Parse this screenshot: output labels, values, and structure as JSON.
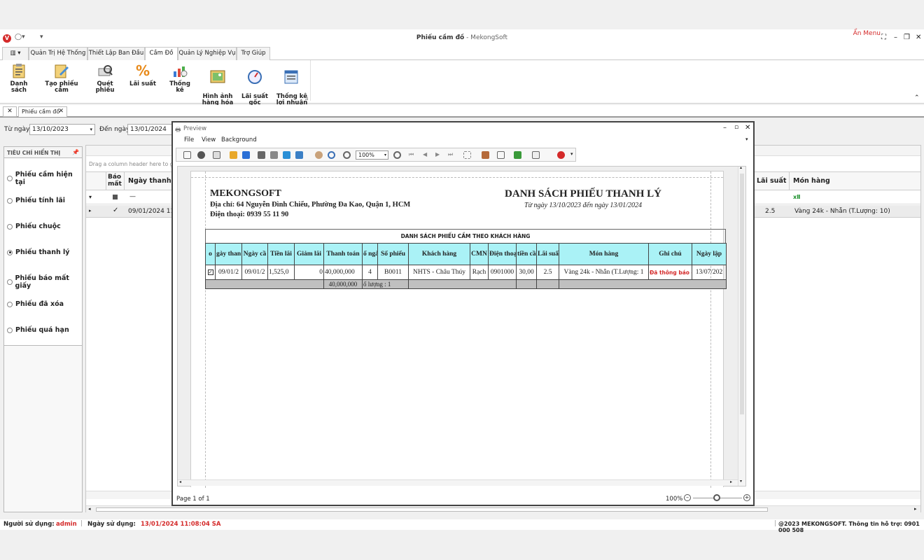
{
  "window": {
    "title_bold": "Phiếu cầm đồ",
    "title_rest": " - MekongSoft",
    "hide_menu": "Ẩn Menu",
    "logo": "V"
  },
  "tabs": [
    "Quản Trị Hệ Thống",
    "Thiết Lập Ban Đầu",
    "Cầm Đồ",
    "Quản Lý Nghiệp Vụ",
    "Trợ Giúp"
  ],
  "ribbon": {
    "buttons": [
      "Danh sách",
      "Tạo phiếu cầm",
      "Quét phiếu",
      "Lãi suất",
      "Thống kê",
      "Hình ảnh\nhàng hóa",
      "Lãi suất\ngốc",
      "Thống kê\nlợi nhuận"
    ]
  },
  "doc_tab": "Phiếu cầm đồ",
  "filter": {
    "from_label": "Từ ngày",
    "from_value": "13/10/2023",
    "to_label": "Đến ngày",
    "to_value": "13/01/2024"
  },
  "left_panel": {
    "header": "TIÊU CHÍ HIỂN THỊ",
    "options": [
      "Phiếu cầm hiện tại",
      "Phiếu tính lãi",
      "Phiếu chuộc",
      "Phiếu thanh lý",
      "Phiếu báo mất giấy",
      "Phiếu đã xóa",
      "Phiếu quá hạn"
    ],
    "selected": "Phiếu thanh lý"
  },
  "grid": {
    "group_hint": "Drag a column header here to grou",
    "headers": {
      "bao_mat": "Báo mất",
      "ngay_thanh": "Ngày thanh l",
      "lai_suat": "Lãi suất",
      "mon_hang": "Món hàng"
    },
    "filter_row_dash": "—",
    "row": {
      "ngay": "09/01/2024 11.",
      "lai_suat": "2.5",
      "mon_hang": "Vàng 24k - Nhẫn (T.Lượng: 10)"
    }
  },
  "preview": {
    "title": "Preview",
    "menu": [
      "File",
      "View",
      "Background"
    ],
    "zoom": "100%",
    "page_info": "Page 1 of 1",
    "zoom_footer": "100%",
    "report": {
      "company": "MEKONGSOFT",
      "address": "Địa chỉ: 64 Nguyễn Đình Chiểu, Phường Đa Kao, Quận 1, HCM",
      "phone": "Điện thoại: 0939 55 11 90",
      "title": "DANH SÁCH PHIẾU THANH LÝ",
      "subtitle": "Từ ngày 13/10/2023 đến ngày 13/01/2024",
      "table_caption": "DANH SÁCH PHIẾU CẦM THEO KHÁCH HÀNG",
      "columns": [
        "o",
        "gày than",
        "Ngày cầ",
        "Tiền lãi",
        "Giảm lãi",
        "Thanh toán",
        "ố ngà",
        "Số phiếu",
        "Khách hàng",
        "CMN",
        "Điện thoạ",
        "tiền cầ",
        "Lãi suấ",
        "Món hàng",
        "Ghi chú",
        "Ngày lập"
      ],
      "row": [
        "",
        "09/01/2",
        "09/01/2",
        "1,525,0",
        "0",
        "40,000,000",
        "4",
        "B0011",
        "NHTS - Châu Thúy",
        "Rạch",
        "0901000",
        "30,00",
        "2.5",
        "Vàng 24k - Nhẫn (T.Lượng: 1",
        "Đã thông báo q",
        "13/07/202"
      ],
      "total_payment": "40,000,000",
      "total_count": "ố lượng : 1"
    }
  },
  "status": {
    "user_label": "Người sử dụng:",
    "user_value": "admin",
    "date_label": "Ngày sử dụng:",
    "date_value": "13/01/2024 11:08:04 SA",
    "copyright": "@2023 MEKONGSOFT. Thông tin hỗ trợ: 0901 000 508"
  },
  "colors": {
    "accent_red": "#d42a2a",
    "header_cyan": "#aaf2f6",
    "summary_gray": "#c0c0c0"
  }
}
